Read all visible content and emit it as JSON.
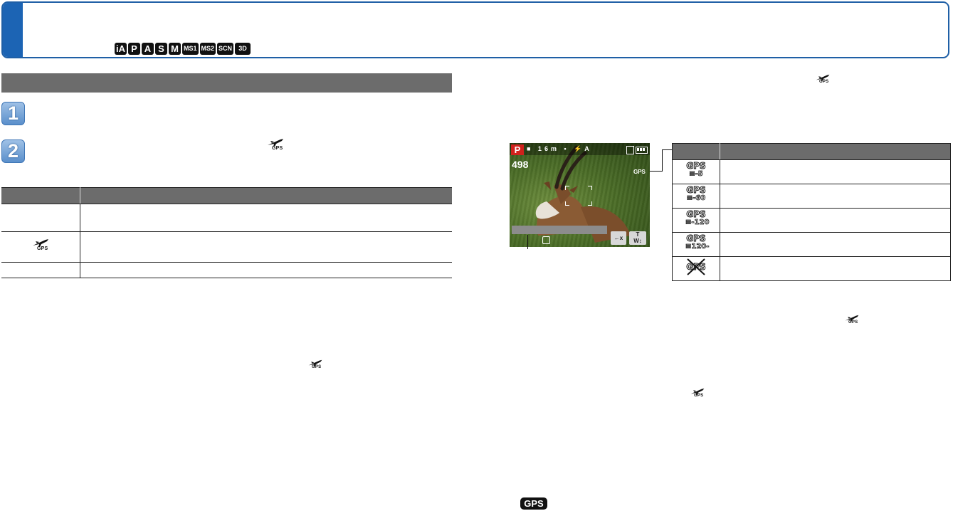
{
  "header": {
    "mode_icons": [
      "iA",
      "P",
      "A",
      "S",
      "M",
      "MS1",
      "MS2",
      "SCN",
      "3D"
    ]
  },
  "left": {
    "steps": [
      "1",
      "2"
    ],
    "step2_icon": "airplane-gps-icon",
    "gps_small_label": "GPS",
    "table": {
      "header": [
        "",
        ""
      ],
      "rows": [
        {
          "col1": "",
          "col1_icon": "",
          "col2": ""
        },
        {
          "col1": "GPS",
          "col1_icon": "airplane-gps-icon",
          "col2": ""
        },
        {
          "col1": "",
          "col1_icon": "",
          "col2": ""
        }
      ]
    },
    "inline_icon_text": "GPS"
  },
  "lcd": {
    "mode": "P",
    "top_icons": "■ 16m • ⚡A",
    "shots_remaining": "498",
    "gps_status": "GPS",
    "btn_a": "←x",
    "btn_b_top": "T",
    "btn_b_bottom": "W↕"
  },
  "right": {
    "top_icon_label": "GPS",
    "table": {
      "header": [
        "",
        ""
      ],
      "rows": [
        {
          "gps": "GPS",
          "sub": "≡-5",
          "text": ""
        },
        {
          "gps": "GPS",
          "sub": "≡-60",
          "text": ""
        },
        {
          "gps": "GPS",
          "sub": "≡-120",
          "text": ""
        },
        {
          "gps": "GPS",
          "sub": "≡120-",
          "text": ""
        },
        {
          "gps": "GPS",
          "sub": "",
          "text": "",
          "crossed": true
        }
      ]
    },
    "mid_icon_label": "GPS",
    "lower_icon_label": "GPS",
    "bottom_badge": "GPS"
  },
  "colors": {
    "banner_blue": "#1c64b4",
    "bar_gray": "#6c6c6c",
    "lcd_mode_red": "#d0211c"
  }
}
